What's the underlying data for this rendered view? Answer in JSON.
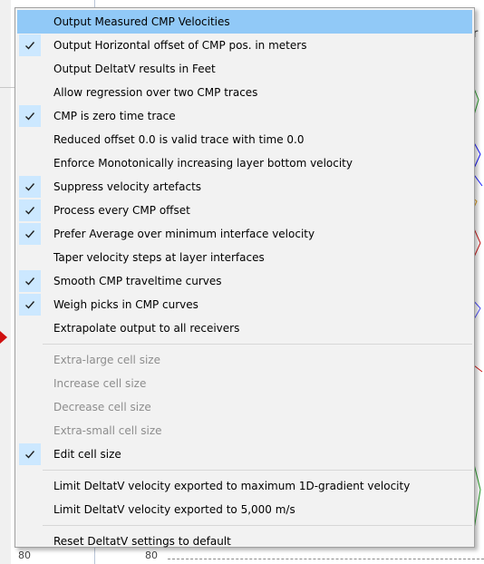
{
  "background": {
    "partial_char": "r",
    "axis_numbers": [
      "80",
      "80"
    ]
  },
  "menu": {
    "items": [
      {
        "label": "Output Measured CMP Velocities",
        "checked": false,
        "enabled": true,
        "highlighted": true
      },
      {
        "label": "Output Horizontal offset of CMP pos. in meters",
        "checked": true,
        "enabled": true
      },
      {
        "label": "Output DeltatV results in Feet",
        "checked": false,
        "enabled": true
      },
      {
        "label": "Allow regression over two CMP traces",
        "checked": false,
        "enabled": true
      },
      {
        "label": "CMP is zero time trace",
        "checked": true,
        "enabled": true
      },
      {
        "label": "Reduced offset 0.0 is valid trace with time 0.0",
        "checked": false,
        "enabled": true
      },
      {
        "label": "Enforce Monotonically increasing layer bottom velocity",
        "checked": false,
        "enabled": true
      },
      {
        "label": "Suppress velocity artefacts",
        "checked": true,
        "enabled": true
      },
      {
        "label": "Process every CMP offset",
        "checked": true,
        "enabled": true
      },
      {
        "label": "Prefer Average over minimum interface velocity",
        "checked": true,
        "enabled": true
      },
      {
        "label": "Taper velocity steps at layer interfaces",
        "checked": false,
        "enabled": true
      },
      {
        "label": "Smooth CMP traveltime curves",
        "checked": true,
        "enabled": true
      },
      {
        "label": "Weigh picks in CMP curves",
        "checked": true,
        "enabled": true
      },
      {
        "label": "Extrapolate output to all receivers",
        "checked": false,
        "enabled": true
      }
    ],
    "cell_items": [
      {
        "label": "Extra-large cell size",
        "checked": false,
        "enabled": false
      },
      {
        "label": "Increase cell size",
        "checked": false,
        "enabled": false
      },
      {
        "label": "Decrease cell size",
        "checked": false,
        "enabled": false
      },
      {
        "label": "Extra-small cell size",
        "checked": false,
        "enabled": false
      },
      {
        "label": "Edit cell size",
        "checked": true,
        "enabled": true
      }
    ],
    "limit_items": [
      {
        "label": "Limit DeltatV velocity exported to maximum 1D-gradient velocity",
        "checked": false,
        "enabled": true
      },
      {
        "label": "Limit DeltatV velocity exported to 5,000 m/s",
        "checked": false,
        "enabled": true
      }
    ],
    "reset_items": [
      {
        "label": "Reset DeltatV settings to default",
        "checked": false,
        "enabled": true
      }
    ]
  },
  "colors": {
    "highlight": "#91c9f7",
    "check_background": "#cce8ff",
    "disabled_text": "#8d8d8d"
  }
}
